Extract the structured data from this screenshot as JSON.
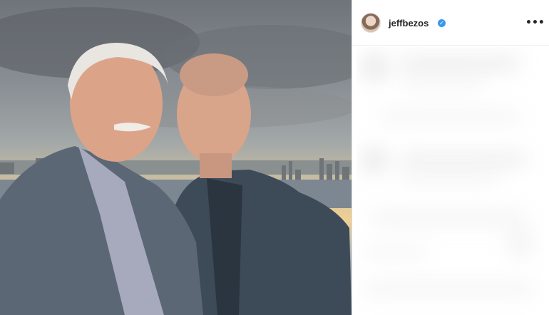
{
  "post": {
    "username": "jeffbezos",
    "verified_icon": "verified-badge-icon",
    "more_icon": "more-options-icon",
    "more_glyph": "•••"
  },
  "colors": {
    "verified": "#3897f0",
    "username": "#262626",
    "divider": "#dbdbdb"
  }
}
